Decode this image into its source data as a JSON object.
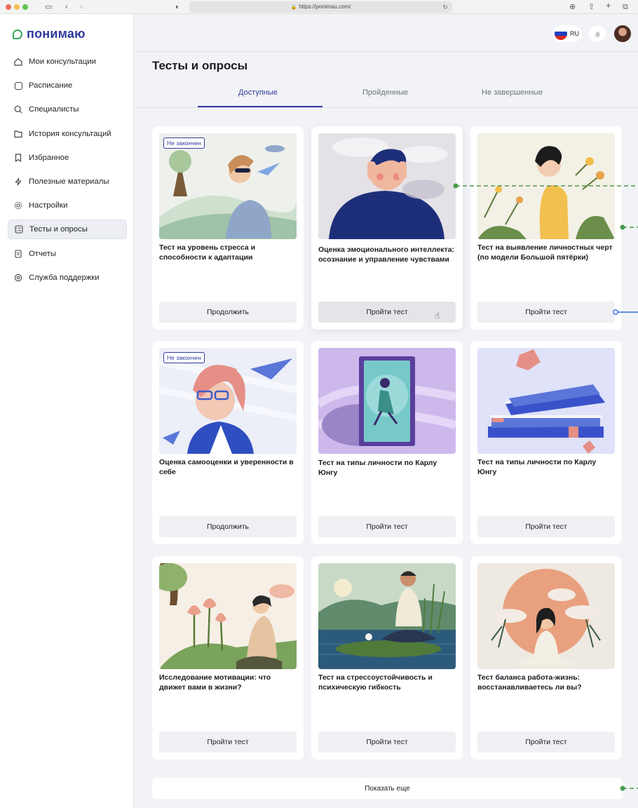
{
  "browser": {
    "url": "https://ponimau.com/",
    "icons": [
      "sidebar-toggle-icon",
      "back-icon",
      "forward-icon",
      "shield-icon",
      "reload-icon",
      "download-icon",
      "share-icon",
      "new-tab-icon",
      "tabs-overview-icon"
    ]
  },
  "app": {
    "logo_text": "понимаю"
  },
  "sidebar": {
    "items": [
      {
        "label": "Мои консультации",
        "icon": "home-icon",
        "active": false
      },
      {
        "label": "Расписание",
        "icon": "calendar-icon",
        "active": false
      },
      {
        "label": "Специалисты",
        "icon": "search-icon",
        "active": false
      },
      {
        "label": "История консультаций",
        "icon": "folder-icon",
        "active": false
      },
      {
        "label": "Избранное",
        "icon": "bookmark-icon",
        "active": false
      },
      {
        "label": "Полезные материалы",
        "icon": "lightning-icon",
        "active": false
      },
      {
        "label": "Настройки",
        "icon": "gear-icon",
        "active": false
      },
      {
        "label": "Тесты и опросы",
        "icon": "checklist-icon",
        "active": true
      },
      {
        "label": "Отчеты",
        "icon": "report-icon",
        "active": false
      },
      {
        "label": "Служба поддержки",
        "icon": "support-icon",
        "active": false
      }
    ]
  },
  "header": {
    "lang": "RU"
  },
  "main": {
    "title": "Тесты и опросы",
    "tabs": [
      {
        "label": "Доступные",
        "active": true
      },
      {
        "label": "Пройденные",
        "active": false
      },
      {
        "label": "Не завершенные",
        "active": false
      }
    ],
    "cards": [
      {
        "title": "Тест на уровень стресса и способности к адаптации",
        "button": "Продолжить",
        "badge": "Не закончен"
      },
      {
        "title": "Оценка эмоционального интеллекта: осознание и управление чувствами",
        "button": "Пройти тест",
        "badge": ""
      },
      {
        "title": "Тест на выявление личностных черт (по модели Большой пятёрки)",
        "button": "Пройти тест",
        "badge": ""
      },
      {
        "title": "Оценка самооценки и уверенности в себе",
        "button": "Продолжить",
        "badge": "Не закончен"
      },
      {
        "title": "Тест на типы личности по Карлу Юнгу",
        "button": "Пройти тест",
        "badge": ""
      },
      {
        "title": "Тест на типы личности по Карлу Юнгу",
        "button": "Пройти тест",
        "badge": ""
      },
      {
        "title": "Исследование мотивации: что движет вами в жизни?",
        "button": "Пройти тест",
        "badge": ""
      },
      {
        "title": "Тест на стрессоустойчивость и психическую гибкость",
        "button": "Пройти тест",
        "badge": ""
      },
      {
        "title": "Тест баланса работа-жизнь: восстанавливаетесь ли вы?",
        "button": "Пройти тест",
        "badge": ""
      }
    ],
    "show_more": "Показать еще"
  },
  "colors": {
    "accent": "#2f3b9c",
    "logo_green": "#3aa65a",
    "connector_green": "#4a9a4f",
    "connector_blue": "#2f6bd6"
  }
}
